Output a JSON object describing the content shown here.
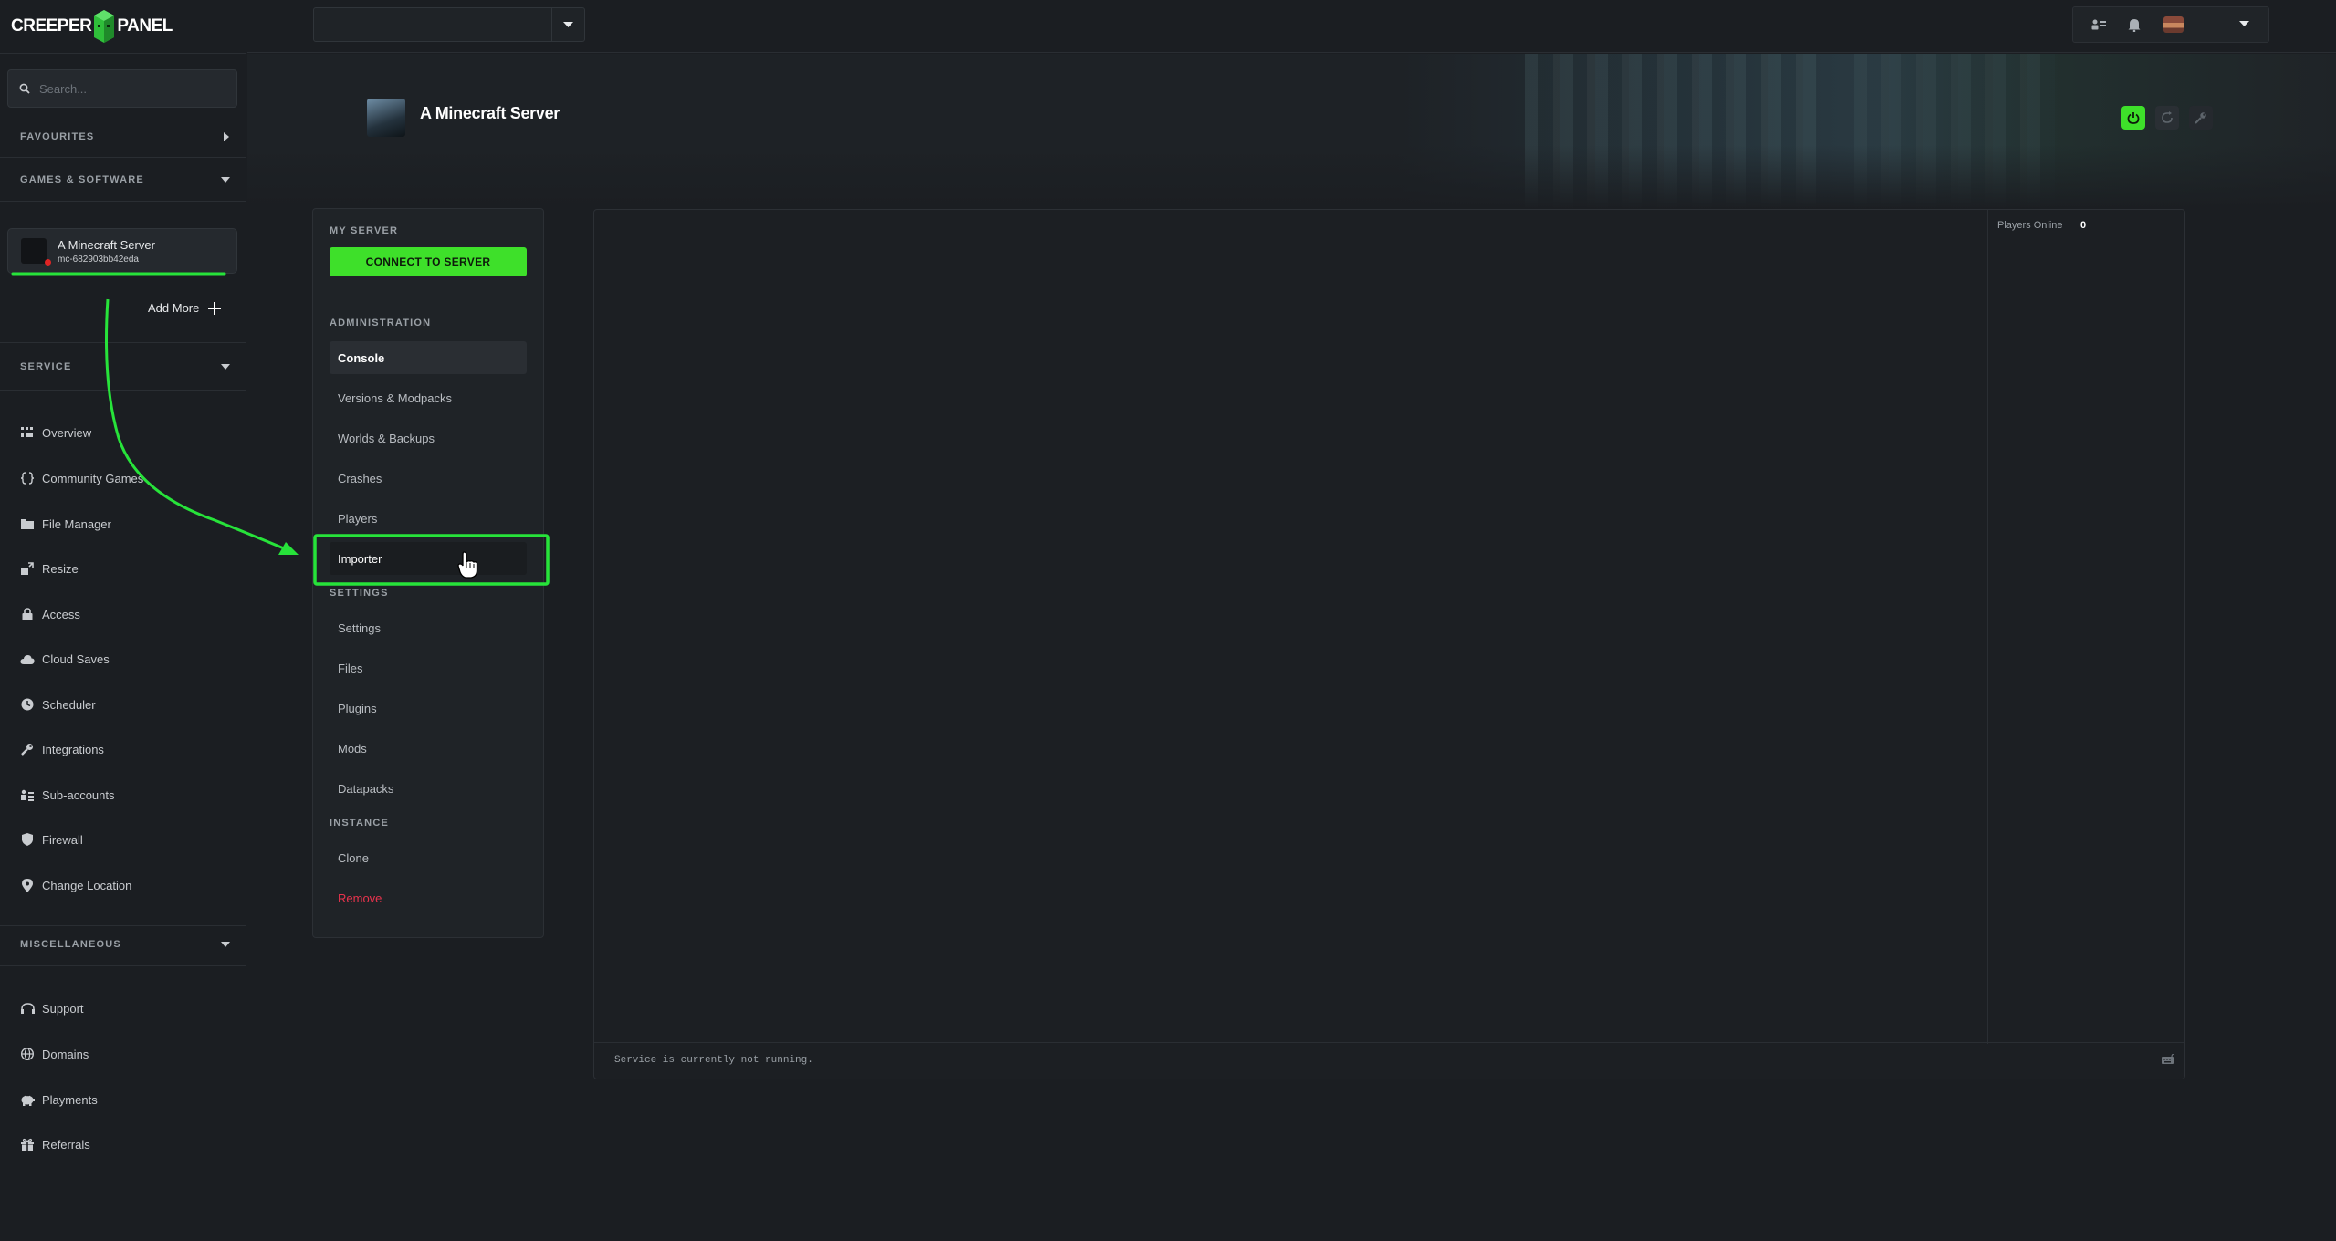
{
  "app": {
    "logo_left": "CREEPER",
    "logo_right": "PANEL"
  },
  "sidebar": {
    "search_placeholder": "Search...",
    "favourites": "FAVOURITES",
    "games_software": "GAMES & SOFTWARE",
    "server": {
      "name": "A Minecraft Server",
      "id": "mc-682903bb42eda",
      "status_color": "#e02424"
    },
    "add_more": "Add More",
    "service": "SERVICE",
    "service_items": [
      {
        "label": "Overview",
        "icon": "grid-icon"
      },
      {
        "label": "Community Games",
        "icon": "braces-icon"
      },
      {
        "label": "File Manager",
        "icon": "folder-icon"
      },
      {
        "label": "Resize",
        "icon": "resize-icon"
      },
      {
        "label": "Access",
        "icon": "lock-icon"
      },
      {
        "label": "Cloud Saves",
        "icon": "cloud-icon"
      },
      {
        "label": "Scheduler",
        "icon": "clock-icon"
      },
      {
        "label": "Integrations",
        "icon": "wrench-icon"
      },
      {
        "label": "Sub-accounts",
        "icon": "users-icon"
      },
      {
        "label": "Firewall",
        "icon": "shield-icon"
      },
      {
        "label": "Change Location",
        "icon": "map-pin-icon"
      }
    ],
    "miscellaneous": "MISCELLANEOUS",
    "misc_items": [
      {
        "label": "Support",
        "icon": "support-icon"
      },
      {
        "label": "Domains",
        "icon": "globe-icon"
      },
      {
        "label": "Playments",
        "icon": "piggy-bank-icon"
      },
      {
        "label": "Referrals",
        "icon": "gift-icon"
      }
    ]
  },
  "header": {
    "title": "A Minecraft Server"
  },
  "subnav": {
    "my_server": "MY SERVER",
    "connect": "CONNECT TO SERVER",
    "administration": "ADMINISTRATION",
    "admin_items": [
      "Console",
      "Versions & Modpacks",
      "Worlds & Backups",
      "Crashes",
      "Players",
      "Importer"
    ],
    "settings": "SETTINGS",
    "settings_items": [
      "Settings",
      "Files",
      "Plugins",
      "Mods",
      "Datapacks"
    ],
    "instance": "INSTANCE",
    "instance_items": [
      "Clone",
      "Remove"
    ]
  },
  "console": {
    "players_online_label": "Players Online",
    "players_online_value": "0",
    "status": "Service is currently not running."
  },
  "colors": {
    "accent": "#3ee02a",
    "danger": "#e8334d",
    "background": "#1b1e22"
  }
}
